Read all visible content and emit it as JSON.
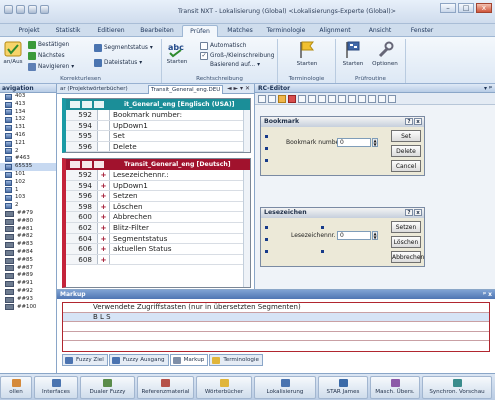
{
  "window": {
    "title": "Transit NXT - Lokalisierung (Global) <Lokalisierungs-Experte (Global)>",
    "controls": [
      "–",
      "□",
      "x"
    ]
  },
  "ribbon_tabs": [
    "Projekt",
    "Statistik",
    "Editieren",
    "Bearbeiten",
    "Prüfen",
    "Matches",
    "Terminologie",
    "Alignment",
    "Ansicht",
    "Fenster"
  ],
  "ribbon": {
    "group1": {
      "big_button": "an/Aus",
      "items": [
        "Bestätigen",
        "Nächstes",
        "Navigieren"
      ],
      "items_right": [
        "Segmentstatus",
        "Dateistatus"
      ],
      "label": "Korrekturlesen"
    },
    "group2": {
      "big_button": "Starten",
      "checks": [
        "Automatisch",
        "Groß-/Kleinschreibung",
        "Basierend auf..."
      ],
      "label": "Rechtschreibung"
    },
    "group3": {
      "big_button": "Starten",
      "label": "Terminologie"
    },
    "group4": {
      "buttons": [
        "Starten",
        "Optionen"
      ],
      "label": "Prüfroutine"
    }
  },
  "left_panel": {
    "title": "avigation",
    "items": [
      "403",
      "413",
      "134",
      "132",
      "131",
      "416",
      "121",
      "2",
      "#463",
      "65535",
      "101",
      "102",
      "1",
      "103",
      "2",
      "##79",
      "##80",
      "##81",
      "##82",
      "##83",
      "##84",
      "##85",
      "##87",
      "##89",
      "##91",
      "##92",
      "##93",
      "##100"
    ],
    "highlighted_index": 9
  },
  "doc_tabs": [
    "ar (Projektwörterbücher)",
    "Transit_General_eng.DEU"
  ],
  "doc_nav": "◄ ► ▾ ✕",
  "source": {
    "title": "it_General_eng [Englisch (USA)]",
    "segments": [
      {
        "num": "592",
        "text": "Bookmark number:"
      },
      {
        "num": "594",
        "text": "UpDown1"
      },
      {
        "num": "595",
        "text": "Set"
      },
      {
        "num": "596",
        "text": "Delete"
      }
    ]
  },
  "target": {
    "title": "Transit_General_eng [Deutsch]",
    "segments": [
      {
        "num": "592",
        "mark": "+",
        "text": "Lesezeichennr.:"
      },
      {
        "num": "594",
        "mark": "+",
        "text": "UpDown1"
      },
      {
        "num": "596",
        "mark": "+",
        "text": "Setzen"
      },
      {
        "num": "598",
        "mark": "+",
        "text": "Löschen"
      },
      {
        "num": "600",
        "mark": "+",
        "text": "Abbrechen"
      },
      {
        "num": "602",
        "mark": "+",
        "text": "Blitz-Filter"
      },
      {
        "num": "604",
        "mark": "+",
        "text": "Segmentstatus"
      },
      {
        "num": "606",
        "mark": "+",
        "text": "aktuellen Status"
      },
      {
        "num": "608",
        "mark": "+",
        "text": ""
      }
    ]
  },
  "rc_editor": {
    "title": "RC-Editor",
    "dialog1": {
      "title": "Bookmark",
      "title_buttons": [
        "?",
        "x"
      ],
      "label": "Bookmark number",
      "value": "0",
      "buttons": [
        "Set",
        "Delete",
        "Cancel"
      ]
    },
    "dialog2": {
      "title": "Lesezeichen",
      "title_buttons": [
        "?",
        "x"
      ],
      "label": "Lesezeichennr.",
      "value": "0",
      "buttons": [
        "Setzen",
        "Löschen",
        "Abbrechen"
      ]
    }
  },
  "markup": {
    "title": "Markup",
    "rows": [
      "Verwendete Zugriffstasten (nur in übersetzten Segmenten)",
      "B L S",
      "",
      "",
      ""
    ],
    "tabs": [
      "Fuzzy Ziel",
      "Fuzzy Ausgang",
      "Markup",
      "Terminologie"
    ],
    "active_tab": 2
  },
  "bottom_bar": [
    "ollen",
    "Interfaces",
    "Dualer Fuzzy",
    "Referenzmaterial",
    "Wörterbücher",
    "Lokalisierung",
    "STAR James",
    "Masch. Übers.",
    "Synchron. Vorschau"
  ],
  "colors": {
    "source_accent": "#1b8e98",
    "target_accent": "#a1122d",
    "ribbon_bg": "#dde8f5"
  }
}
